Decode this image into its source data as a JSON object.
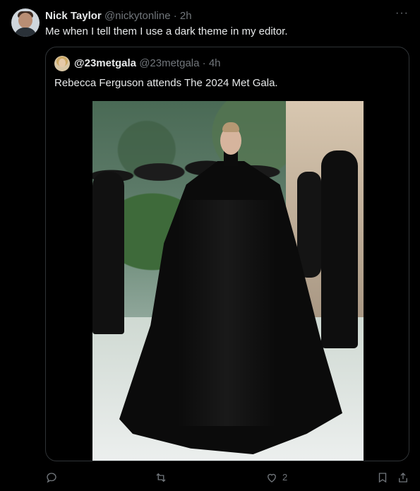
{
  "post": {
    "author_name": "Nick Taylor",
    "author_handle": "@nickytonline",
    "separator": "·",
    "time": "2h",
    "text": "Me when I tell them I use a dark theme in my editor.",
    "more_label": "···"
  },
  "quote": {
    "author_name": "@23metgala",
    "author_handle": "@23metgala",
    "separator": "·",
    "time": "4h",
    "text": "Rebecca Ferguson attends The 2024 Met Gala."
  },
  "actions": {
    "reply_count": "",
    "repost_count": "",
    "like_count": "2",
    "bookmark_count": "",
    "share_count": ""
  },
  "icons": {
    "reply": "reply-icon",
    "repost": "repost-icon",
    "like": "like-icon",
    "bookmark": "bookmark-icon",
    "share": "share-icon",
    "more": "more-icon"
  },
  "colors": {
    "background": "#000000",
    "text": "#e7e9ea",
    "muted": "#71767b",
    "border": "#2f3336"
  }
}
